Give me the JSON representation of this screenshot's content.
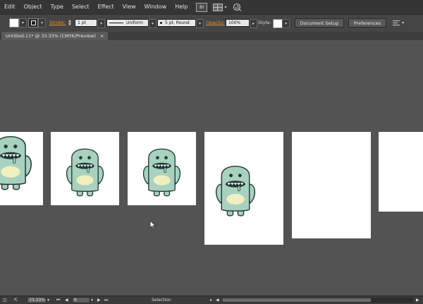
{
  "menubar": {
    "items": [
      "Edit",
      "Object",
      "Type",
      "Select",
      "Effect",
      "View",
      "Window",
      "Help"
    ],
    "bridge_label": "Br"
  },
  "controlbar": {
    "stroke_label": "Stroke:",
    "stroke_weight": "1 pt",
    "stroke_profile": "Uniform",
    "brush": "5 pt. Round",
    "opacity_label": "Opacity:",
    "opacity_value": "100%",
    "style_label": "Style:",
    "document_setup": "Document Setup",
    "preferences": "Preferences"
  },
  "document_tab": {
    "title": "Untitled-11* @ 33.33% (CMYK/Preview)",
    "close": "×"
  },
  "statusbar": {
    "zoom": "33.33%",
    "artboard_number": "6",
    "tool_name": "Selection"
  },
  "colors": {
    "monster_body": "#a9d1bf",
    "monster_outline": "#1f3633",
    "belly": "#f1efbf",
    "canvas_bg": "#535353",
    "link_orange": "#e8912b"
  }
}
